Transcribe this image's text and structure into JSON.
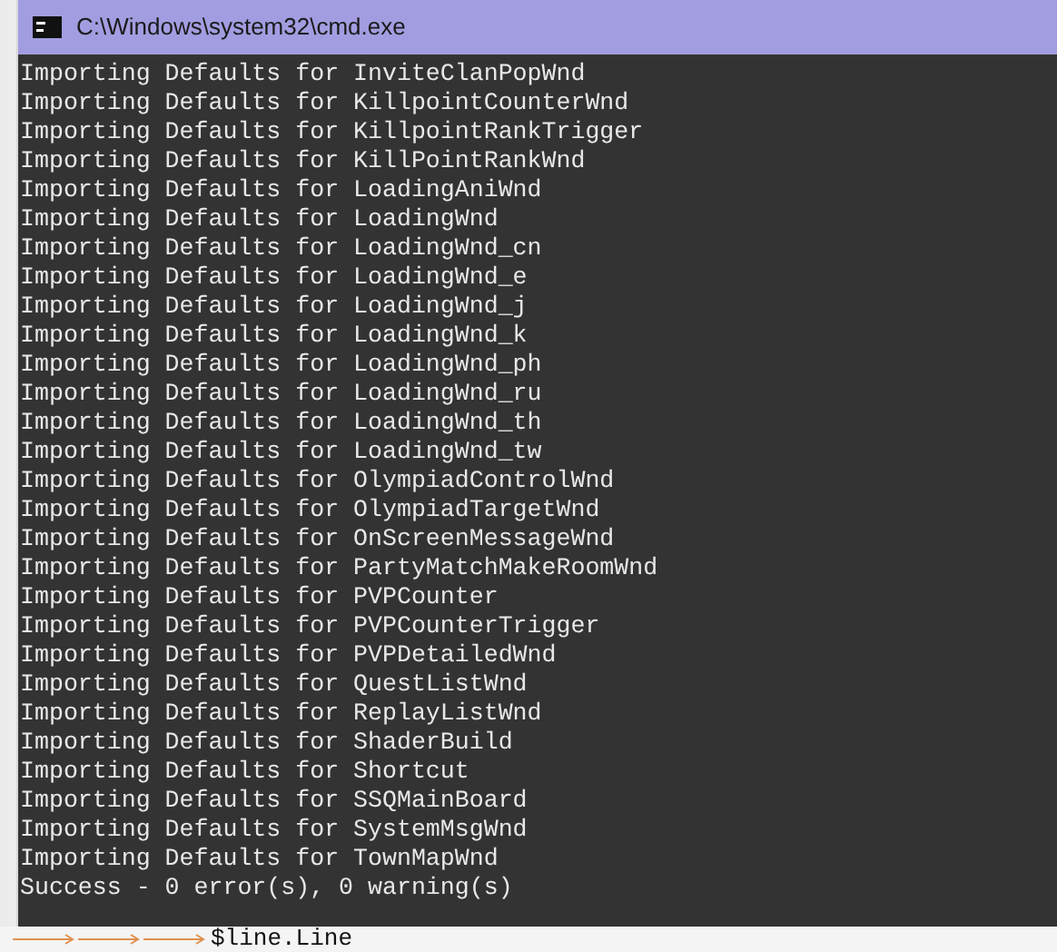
{
  "window": {
    "title": "C:\\Windows\\system32\\cmd.exe"
  },
  "console": {
    "lines": [
      "Importing Defaults for InviteClanPopWnd",
      "Importing Defaults for KillpointCounterWnd",
      "Importing Defaults for KillpointRankTrigger",
      "Importing Defaults for KillPointRankWnd",
      "Importing Defaults for LoadingAniWnd",
      "Importing Defaults for LoadingWnd",
      "Importing Defaults for LoadingWnd_cn",
      "Importing Defaults for LoadingWnd_e",
      "Importing Defaults for LoadingWnd_j",
      "Importing Defaults for LoadingWnd_k",
      "Importing Defaults for LoadingWnd_ph",
      "Importing Defaults for LoadingWnd_ru",
      "Importing Defaults for LoadingWnd_th",
      "Importing Defaults for LoadingWnd_tw",
      "Importing Defaults for OlympiadControlWnd",
      "Importing Defaults for OlympiadTargetWnd",
      "Importing Defaults for OnScreenMessageWnd",
      "Importing Defaults for PartyMatchMakeRoomWnd",
      "Importing Defaults for PVPCounter",
      "Importing Defaults for PVPCounterTrigger",
      "Importing Defaults for PVPDetailedWnd",
      "Importing Defaults for QuestListWnd",
      "Importing Defaults for ReplayListWnd",
      "Importing Defaults for ShaderBuild",
      "Importing Defaults for Shortcut",
      "Importing Defaults for SSQMainBoard",
      "Importing Defaults for SystemMsgWnd",
      "Importing Defaults for TownMapWnd",
      "Success - 0 error(s), 0 warning(s)"
    ]
  },
  "editor": {
    "visible_line": {
      "indent": [
        {
          "kind": "tab"
        },
        {
          "kind": "tab"
        },
        {
          "kind": "tab"
        }
      ],
      "code": "$line.Line"
    }
  }
}
